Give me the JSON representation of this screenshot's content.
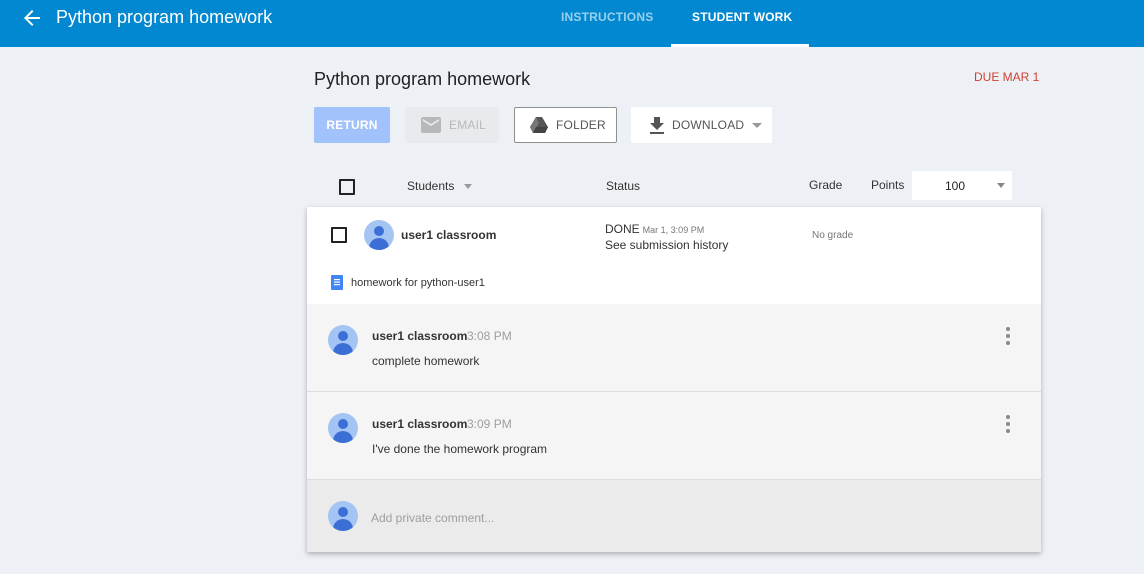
{
  "header": {
    "title": "Python program homework",
    "tabs": [
      {
        "label": "INSTRUCTIONS",
        "active": false
      },
      {
        "label": "STUDENT WORK",
        "active": true
      }
    ]
  },
  "assignment": {
    "title": "Python program homework",
    "due": "DUE MAR 1"
  },
  "toolbar": {
    "return_label": "RETURN",
    "email_label": "EMAIL",
    "folder_label": "FOLDER",
    "download_label": "DOWNLOAD"
  },
  "columns": {
    "students": "Students",
    "status": "Status",
    "grade": "Grade",
    "points": "Points",
    "points_value": "100"
  },
  "student": {
    "name": "user1 classroom",
    "status": "DONE",
    "status_time": "Mar 1, 3:09 PM",
    "history_link": "See submission history",
    "grade": "No grade",
    "attachment": "homework for python-user1"
  },
  "comments": [
    {
      "author": "user1 classroom",
      "time": "3:08 PM",
      "text": "complete homework"
    },
    {
      "author": "user1 classroom",
      "time": "3:09 PM",
      "text": "I've done the homework program"
    }
  ],
  "add_comment": {
    "placeholder": "Add private comment..."
  },
  "colors": {
    "topbar": "#0288d1",
    "due": "#d23f31",
    "return_button": "#a1c2fa",
    "avatar": "#a4c4f4"
  },
  "icons": [
    "arrow-back-icon",
    "mail-icon",
    "google-drive-icon",
    "download-icon",
    "caret-down-icon",
    "doc-icon",
    "more-vert-icon",
    "person-icon"
  ]
}
